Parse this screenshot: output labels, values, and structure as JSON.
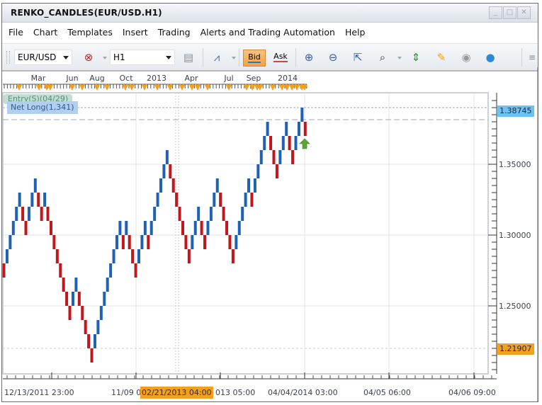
{
  "window": {
    "title": "RENKO_CANDLES(EUR/USD.H1)",
    "controls": [
      "minimize",
      "maximize",
      "close"
    ]
  },
  "menu": [
    "File",
    "Chart",
    "Templates",
    "Insert",
    "Trading",
    "Alerts and Trading Automation",
    "Help"
  ],
  "toolbar": {
    "symbol": "EUR/USD",
    "timeframe": "H1",
    "bid_label": "Bid",
    "ask_label": "Ask",
    "icons": [
      "remove-indicator-icon",
      "chart-properties-icon",
      "chart-type-icon",
      "zoom-in-icon",
      "zoom-out-icon",
      "zoom-cursor-icon",
      "zoom-area-icon",
      "auto-scale-icon",
      "edit-window-icon",
      "view-icon",
      "globe-icon",
      "overflow-menu-icon"
    ]
  },
  "colors": {
    "up_brick": "#1f62b3",
    "down_brick": "#c0161c",
    "bid_tag": "#6cc2f4",
    "low_tag": "#f5a01d",
    "marker": "#f5a01d",
    "arrow": "#5aa832"
  },
  "overlay": {
    "entry_label": "Entry(S)(04/29)",
    "net_label": "Net Long(1,341)"
  },
  "price_tags": {
    "current": "1.38745",
    "low": "1.21907"
  },
  "time_axis": {
    "labels": [
      "12/13/2011 23:00",
      "11/09 0",
      "013 05:00",
      "04/04/2014 03:00",
      "04/05 06:00",
      "04/06 09:00"
    ],
    "cursor": "02/21/2013 04:00"
  },
  "chart_data": {
    "type": "renko",
    "title": "RENKO_CANDLES(EUR/USD.H1)",
    "brick_size": 0.01,
    "y_ticks": [
      "1.35000",
      "1.30000",
      "1.25000"
    ],
    "ylim": [
      1.205,
      1.395
    ],
    "top_month_labels": [
      "Mar",
      "Jun",
      "Aug",
      "Oct",
      "2013",
      "Apr",
      "Jul",
      "Sep",
      "2014"
    ],
    "event_marker_count": 29,
    "horizontal_lines": [
      {
        "name": "current-bid",
        "value": 1.38745,
        "style": "dotted"
      },
      {
        "name": "entry-line",
        "value": 1.3815,
        "style": "dashed"
      }
    ],
    "bricks": [
      {
        "dir": "down",
        "low": 1.27
      },
      {
        "dir": "up",
        "low": 1.28
      },
      {
        "dir": "up",
        "low": 1.29
      },
      {
        "dir": "up",
        "low": 1.3
      },
      {
        "dir": "up",
        "low": 1.31
      },
      {
        "dir": "up",
        "low": 1.32
      },
      {
        "dir": "down",
        "low": 1.31
      },
      {
        "dir": "down",
        "low": 1.3
      },
      {
        "dir": "up",
        "low": 1.31
      },
      {
        "dir": "up",
        "low": 1.32
      },
      {
        "dir": "up",
        "low": 1.33
      },
      {
        "dir": "down",
        "low": 1.32
      },
      {
        "dir": "down",
        "low": 1.31
      },
      {
        "dir": "up",
        "low": 1.32
      },
      {
        "dir": "down",
        "low": 1.31
      },
      {
        "dir": "down",
        "low": 1.3
      },
      {
        "dir": "down",
        "low": 1.29
      },
      {
        "dir": "down",
        "low": 1.28
      },
      {
        "dir": "down",
        "low": 1.27
      },
      {
        "dir": "down",
        "low": 1.26
      },
      {
        "dir": "down",
        "low": 1.25
      },
      {
        "dir": "down",
        "low": 1.24
      },
      {
        "dir": "up",
        "low": 1.25
      },
      {
        "dir": "up",
        "low": 1.26
      },
      {
        "dir": "down",
        "low": 1.25
      },
      {
        "dir": "down",
        "low": 1.24
      },
      {
        "dir": "down",
        "low": 1.23
      },
      {
        "dir": "down",
        "low": 1.22
      },
      {
        "dir": "down",
        "low": 1.21
      },
      {
        "dir": "up",
        "low": 1.22
      },
      {
        "dir": "up",
        "low": 1.23
      },
      {
        "dir": "up",
        "low": 1.24
      },
      {
        "dir": "up",
        "low": 1.25
      },
      {
        "dir": "up",
        "low": 1.26
      },
      {
        "dir": "up",
        "low": 1.27
      },
      {
        "dir": "up",
        "low": 1.28
      },
      {
        "dir": "up",
        "low": 1.29
      },
      {
        "dir": "up",
        "low": 1.3
      },
      {
        "dir": "down",
        "low": 1.29
      },
      {
        "dir": "up",
        "low": 1.3
      },
      {
        "dir": "down",
        "low": 1.29
      },
      {
        "dir": "down",
        "low": 1.28
      },
      {
        "dir": "down",
        "low": 1.27
      },
      {
        "dir": "up",
        "low": 1.28
      },
      {
        "dir": "up",
        "low": 1.29
      },
      {
        "dir": "up",
        "low": 1.3
      },
      {
        "dir": "down",
        "low": 1.29
      },
      {
        "dir": "up",
        "low": 1.3
      },
      {
        "dir": "up",
        "low": 1.31
      },
      {
        "dir": "up",
        "low": 1.32
      },
      {
        "dir": "up",
        "low": 1.33
      },
      {
        "dir": "up",
        "low": 1.34
      },
      {
        "dir": "up",
        "low": 1.35
      },
      {
        "dir": "down",
        "low": 1.34
      },
      {
        "dir": "down",
        "low": 1.33
      },
      {
        "dir": "down",
        "low": 1.32
      },
      {
        "dir": "down",
        "low": 1.31
      },
      {
        "dir": "down",
        "low": 1.3
      },
      {
        "dir": "down",
        "low": 1.29
      },
      {
        "dir": "down",
        "low": 1.28
      },
      {
        "dir": "up",
        "low": 1.29
      },
      {
        "dir": "up",
        "low": 1.3
      },
      {
        "dir": "up",
        "low": 1.31
      },
      {
        "dir": "down",
        "low": 1.3
      },
      {
        "dir": "down",
        "low": 1.29
      },
      {
        "dir": "up",
        "low": 1.3
      },
      {
        "dir": "up",
        "low": 1.31
      },
      {
        "dir": "up",
        "low": 1.32
      },
      {
        "dir": "up",
        "low": 1.33
      },
      {
        "dir": "down",
        "low": 1.32
      },
      {
        "dir": "down",
        "low": 1.31
      },
      {
        "dir": "down",
        "low": 1.3
      },
      {
        "dir": "down",
        "low": 1.29
      },
      {
        "dir": "down",
        "low": 1.28
      },
      {
        "dir": "up",
        "low": 1.29
      },
      {
        "dir": "up",
        "low": 1.3
      },
      {
        "dir": "up",
        "low": 1.31
      },
      {
        "dir": "up",
        "low": 1.32
      },
      {
        "dir": "up",
        "low": 1.33
      },
      {
        "dir": "down",
        "low": 1.32
      },
      {
        "dir": "up",
        "low": 1.33
      },
      {
        "dir": "up",
        "low": 1.34
      },
      {
        "dir": "up",
        "low": 1.35
      },
      {
        "dir": "up",
        "low": 1.36
      },
      {
        "dir": "up",
        "low": 1.37
      },
      {
        "dir": "down",
        "low": 1.36
      },
      {
        "dir": "down",
        "low": 1.35
      },
      {
        "dir": "down",
        "low": 1.34
      },
      {
        "dir": "up",
        "low": 1.35
      },
      {
        "dir": "up",
        "low": 1.36
      },
      {
        "dir": "up",
        "low": 1.37
      },
      {
        "dir": "down",
        "low": 1.36
      },
      {
        "dir": "down",
        "low": 1.35
      },
      {
        "dir": "up",
        "low": 1.36
      },
      {
        "dir": "up",
        "low": 1.37
      },
      {
        "dir": "up",
        "low": 1.38
      },
      {
        "dir": "down",
        "low": 1.37
      }
    ],
    "signal": {
      "type": "buy-arrow",
      "at_brick": 99,
      "value": 1.363
    }
  }
}
